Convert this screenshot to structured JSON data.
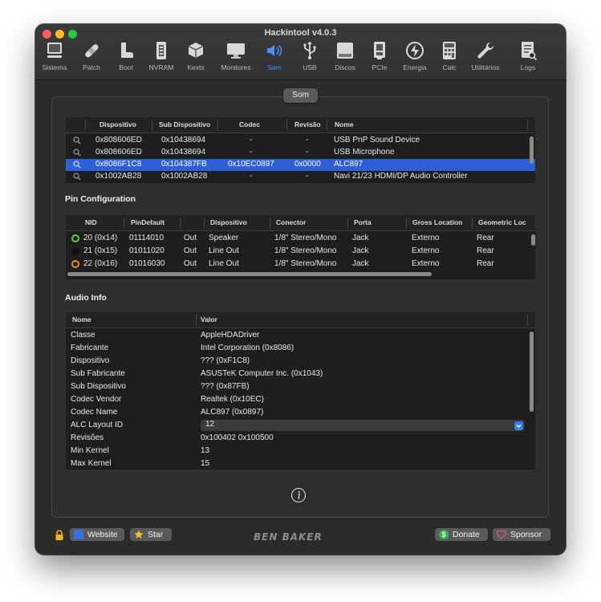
{
  "window": {
    "title": "Hackintool v4.0.3"
  },
  "toolbar": {
    "items": [
      {
        "label": "Sistema",
        "icon": "computer-icon"
      },
      {
        "label": "Patch",
        "icon": "bandage-icon"
      },
      {
        "label": "Boot",
        "icon": "boot-icon"
      },
      {
        "label": "NVRAM",
        "icon": "memory-chip-icon"
      },
      {
        "label": "Kexts",
        "icon": "package-icon"
      },
      {
        "label": "Monitores",
        "icon": "monitor-icon"
      },
      {
        "label": "Som",
        "icon": "speaker-icon"
      },
      {
        "label": "USB",
        "icon": "usb-icon"
      },
      {
        "label": "Discos",
        "icon": "disk-icon"
      },
      {
        "label": "PCIe",
        "icon": "pcie-card-icon"
      },
      {
        "label": "Energia",
        "icon": "energy-icon"
      },
      {
        "label": "Calc",
        "icon": "calculator-icon"
      },
      {
        "label": "Utilitários",
        "icon": "wrench-icon"
      },
      {
        "label": "Logs",
        "icon": "log-icon"
      }
    ],
    "active": "Som"
  },
  "tab": {
    "label": "Som"
  },
  "devices": {
    "headers": [
      "Dispositivo",
      "Sub Dispositivo",
      "Codec",
      "Revisão",
      "Nome"
    ],
    "rows": [
      [
        "0x808606ED",
        "0x10438694",
        "-",
        "-",
        "USB PnP Sound Device"
      ],
      [
        "0x808606ED",
        "0x10438694",
        "-",
        "-",
        "USB Microphone"
      ],
      [
        "0x8086F1C8",
        "0x104387FB",
        "0x10EC0897",
        "0x0000",
        "ALC897"
      ],
      [
        "0x1002AB28",
        "0x1002AB28",
        "-",
        "-",
        "Navi 21/23 HDMI/DP Audio Controller"
      ]
    ],
    "selected_index": 2
  },
  "pin_config": {
    "title": "Pin Configuration",
    "headers": [
      "NID",
      "PinDefault",
      "",
      "Dispositivo",
      "Conector",
      "Porta",
      "Gross Location",
      "Geometric Loc"
    ],
    "rows": [
      [
        "20 (0x14)",
        "01114010",
        "Out",
        "Speaker",
        "1/8\" Stereo/Mono",
        "Jack",
        "Externo",
        "Rear"
      ],
      [
        "21 (0x15)",
        "01011020",
        "Out",
        "Line Out",
        "1/8\" Stereo/Mono",
        "Jack",
        "Externo",
        "Rear"
      ],
      [
        "22 (0x16)",
        "01016030",
        "Out",
        "Line Out",
        "1/8\" Stereo/Mono",
        "Jack",
        "Externo",
        "Rear"
      ]
    ],
    "dot_colors": [
      "#5ed135",
      "#111111",
      "#f08a24"
    ]
  },
  "audio_info": {
    "title": "Audio Info",
    "headers": [
      "Nome",
      "Valor"
    ],
    "rows": [
      [
        "Classe",
        "AppleHDADriver"
      ],
      [
        "Fabricante",
        "Intel Corporation (0x8086)"
      ],
      [
        "Dispositivo",
        "??? (0xF1C8)"
      ],
      [
        "Sub Fabricante",
        "ASUSTeK Computer Inc. (0x1043)"
      ],
      [
        "Sub Dispositivo",
        "??? (0x87FB)"
      ],
      [
        "Codec Vendor",
        "Realtek (0x10EC)"
      ],
      [
        "Codec Name",
        "ALC897 (0x0897)"
      ],
      [
        "ALC Layout ID",
        "12"
      ],
      [
        "Revisões",
        "0x100402 0x100500"
      ],
      [
        "Min Kernel",
        "13"
      ],
      [
        "Max Kernel",
        "15"
      ]
    ]
  },
  "footer": {
    "website": "Website",
    "star": "Star",
    "brand": "BEN BAKER",
    "donate": "Donate",
    "sponsor": "Sponsor"
  },
  "colors": {
    "accent": "#4a90ff",
    "selection": "#2f5fd6",
    "donate": "#2db84a",
    "sponsor": "#e0508a",
    "star": "#f2c12e",
    "lock": "#f2b51c"
  }
}
